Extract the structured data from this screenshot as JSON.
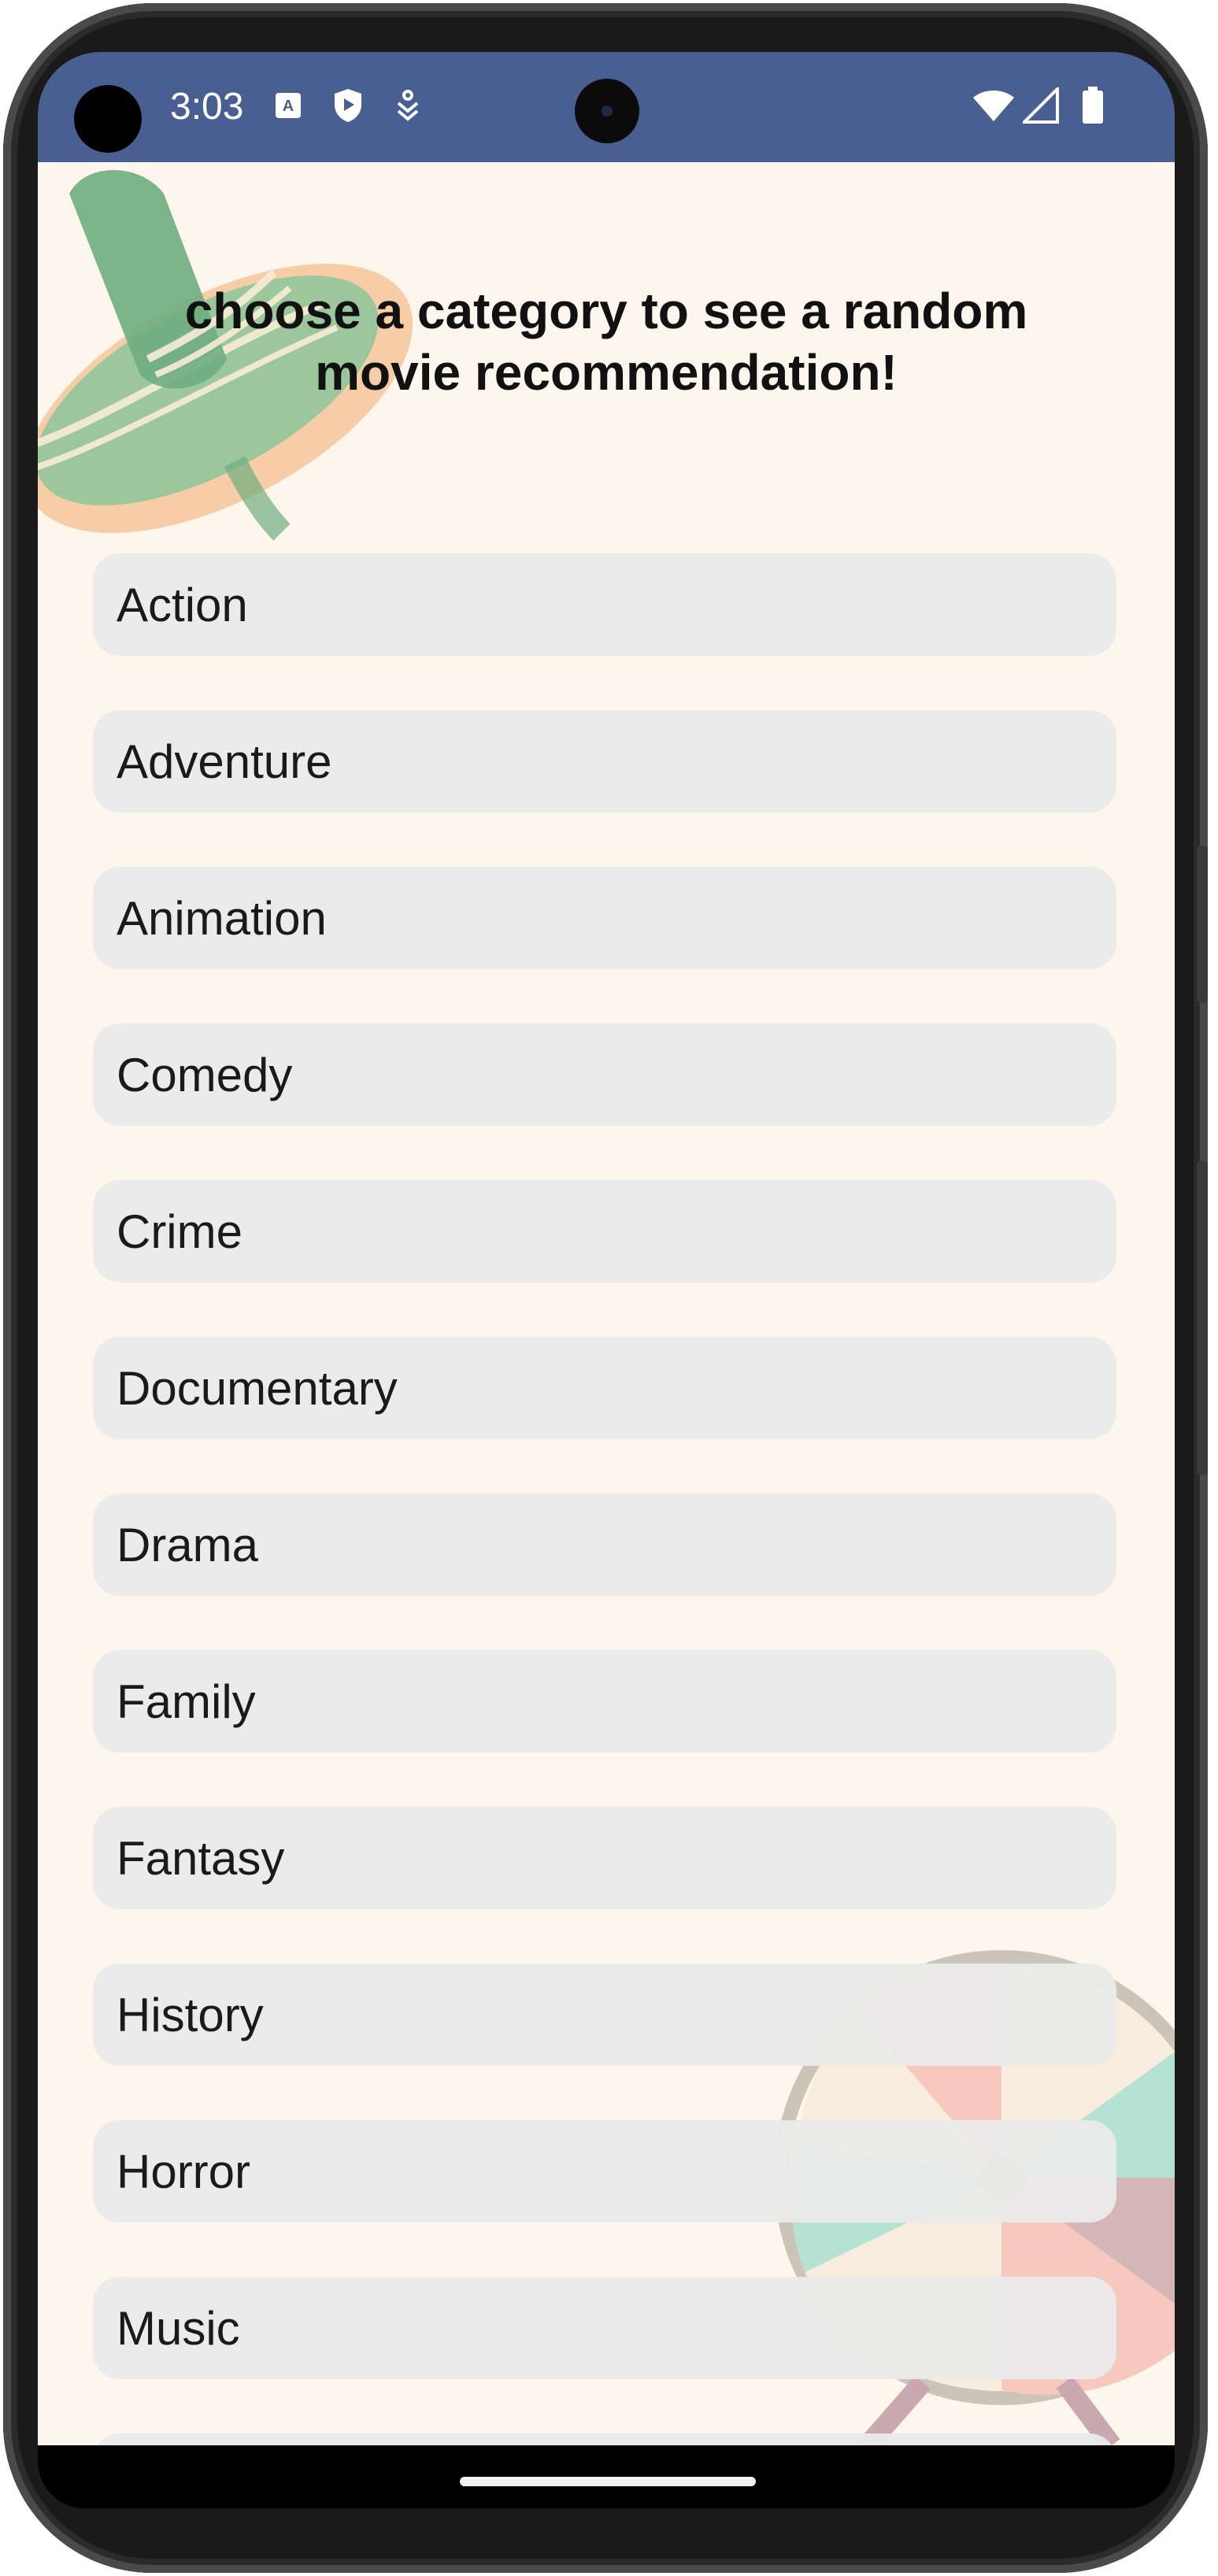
{
  "status_bar": {
    "time": "3:03",
    "left_icons": [
      "font-a-icon",
      "shield-play-icon",
      "download-person-icon"
    ],
    "right_icons": [
      "wifi-icon",
      "signal-icon",
      "battery-icon"
    ],
    "background_color": "#4a5f91"
  },
  "page": {
    "title": "choose a category to see a random movie recommendation!",
    "background_color": "#fdf6ec"
  },
  "categories": [
    {
      "label": "Action"
    },
    {
      "label": "Adventure"
    },
    {
      "label": "Animation"
    },
    {
      "label": "Comedy"
    },
    {
      "label": "Crime"
    },
    {
      "label": "Documentary"
    },
    {
      "label": "Drama"
    },
    {
      "label": "Family"
    },
    {
      "label": "Fantasy"
    },
    {
      "label": "History"
    },
    {
      "label": "Horror"
    },
    {
      "label": "Music"
    },
    {
      "label": ""
    }
  ],
  "decorations": [
    "sombrero-illustration",
    "prize-wheel-illustration"
  ],
  "colors": {
    "button_background": "#eaeaea",
    "title_text": "#111111"
  }
}
